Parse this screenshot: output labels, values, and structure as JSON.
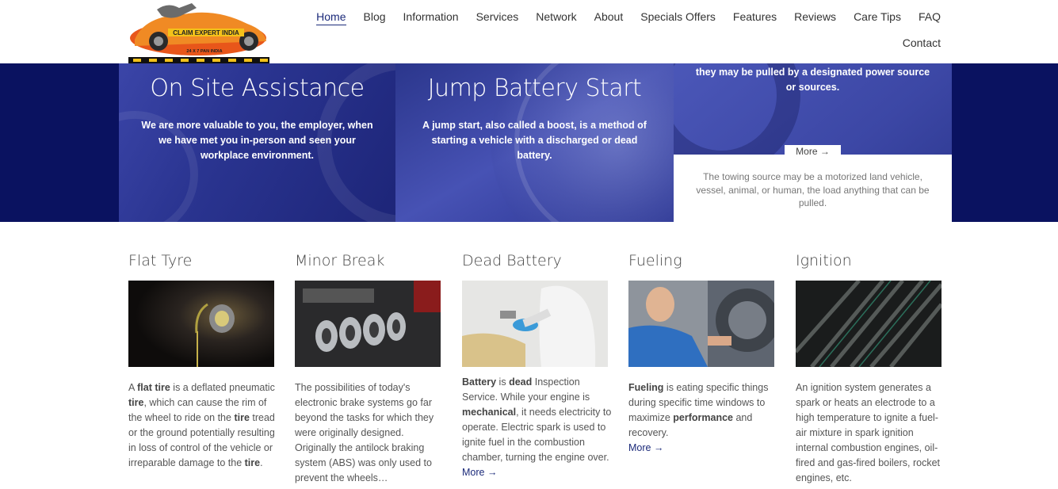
{
  "nav": {
    "items": [
      "Home",
      "Blog",
      "Information",
      "Services",
      "Network",
      "About",
      "Specials Offers",
      "Features",
      "Reviews",
      "Care Tips",
      "FAQ"
    ],
    "row2": [
      "Contact"
    ]
  },
  "logo": {
    "name": "CLAIM EXPERT INDIA",
    "tagline": "24 X 7 PAN INDIA"
  },
  "hero": {
    "panel1": {
      "title": "On Site Assistance",
      "text": "We are more valuable to you, the employer, when we have met you in-person and seen your workplace environment."
    },
    "panel2": {
      "title": "Jump Battery Start",
      "text": "A jump start, also called a boost, is a method of starting a vehicle with a discharged or dead battery."
    },
    "panel3": {
      "text": "they may be pulled by a designated power source or sources.",
      "more": "More →",
      "box_text": "The towing source may be a motorized land vehicle, vessel, animal, or human, the load anything that can be pulled."
    }
  },
  "services": [
    {
      "title": "Flat Tyre",
      "parts": [
        "A ",
        "flat tire",
        " is a deflated pneumatic ",
        "tire",
        ", which can cause the rim of the wheel to ride on the ",
        "tire",
        " tread or the ground potentially resulting in loss of control of the vehicle or irreparable damage to the ",
        "tire",
        "."
      ]
    },
    {
      "title": "Minor Break",
      "text": "The possibilities of today's electronic brake systems go far beyond the tasks for which they were originally designed. Originally the antilock braking system (ABS) was only used to prevent the wheels…"
    },
    {
      "title": "Dead Battery",
      "parts": [
        "Battery",
        " is ",
        "dead",
        " Inspection Service. While your engine is ",
        "mechanical",
        ", it needs electricity to operate. Electric spark is used to ignite fuel in the combustion chamber, turning the engine over."
      ],
      "more": "More →"
    },
    {
      "title": "Fueling",
      "parts": [
        "Fueling",
        " is eating specific things during specific time windows to maximize ",
        "performance",
        " and recovery."
      ],
      "more": "More →"
    },
    {
      "title": "Ignition",
      "text": "An ignition system generates a spark or heats an electrode to a high temperature to ignite a fuel-air mixture in spark ignition internal combustion engines, oil-fired and gas-fired boilers, rocket engines, etc."
    }
  ],
  "colors": {
    "hero_bg": "#0a1260",
    "accent": "#1b2a7a"
  }
}
